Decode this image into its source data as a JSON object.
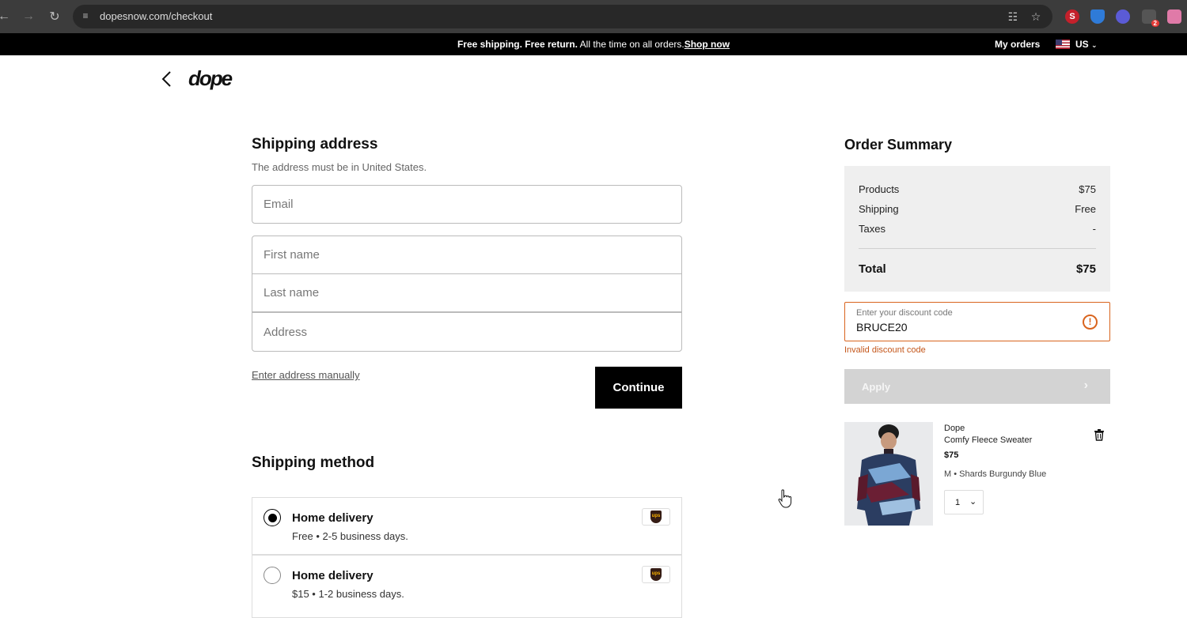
{
  "browser": {
    "url": "dopesnow.com/checkout",
    "extension_badge": "2"
  },
  "promo": {
    "bold_text": "Free shipping. Free return.",
    "text": " All the time on all orders.",
    "link": "Shop now",
    "my_orders": "My orders",
    "locale": "US"
  },
  "header": {
    "logo": "dope"
  },
  "shipping_address": {
    "title": "Shipping address",
    "subtitle": "The address must be in United States.",
    "email_placeholder": "Email",
    "first_name_placeholder": "First name",
    "last_name_placeholder": "Last name",
    "address_placeholder": "Address",
    "manual_link": "Enter address manually",
    "continue_label": "Continue"
  },
  "shipping_method": {
    "title": "Shipping method",
    "options": [
      {
        "title": "Home delivery",
        "desc": "Free  • 2-5 business days.",
        "selected": true,
        "carrier": "ups"
      },
      {
        "title": "Home delivery",
        "desc": "$15  • 1-2 business days.",
        "selected": false,
        "carrier": "ups"
      }
    ]
  },
  "order_summary": {
    "title": "Order Summary",
    "rows": [
      {
        "label": "Products",
        "value": "$75"
      },
      {
        "label": "Shipping",
        "value": "Free"
      },
      {
        "label": "Taxes",
        "value": "-"
      }
    ],
    "total_label": "Total",
    "total_value": "$75",
    "discount_label": "Enter your discount code",
    "discount_value": "BRUCE20",
    "discount_error": "Invalid discount code",
    "apply_label": "Apply"
  },
  "cart_item": {
    "brand": "Dope",
    "name": "Comfy Fleece Sweater",
    "price": "$75",
    "variant": "M • Shards Burgundy Blue",
    "quantity": "1"
  },
  "colors": {
    "error": "#d9641e",
    "primary_button": "#000000",
    "apply_disabled": "#d3d3d3"
  }
}
